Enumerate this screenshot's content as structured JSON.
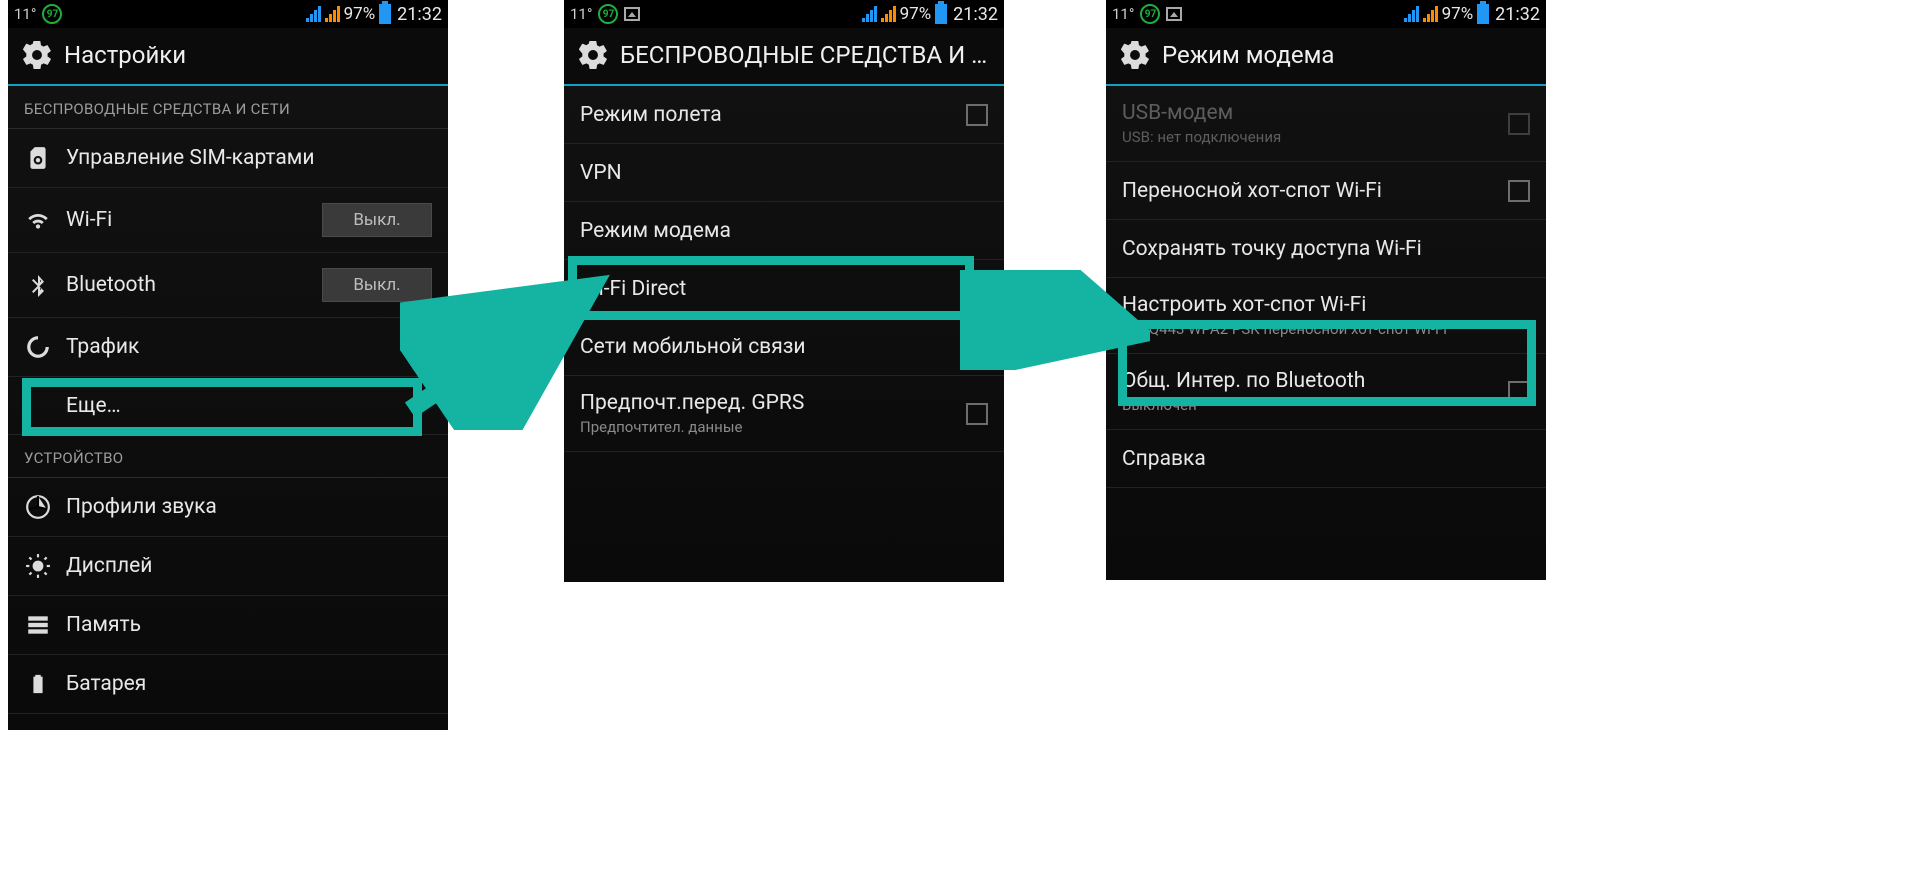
{
  "status": {
    "temp": "11°",
    "badge": "97",
    "battery_pct": "97%",
    "clock": "21:32"
  },
  "screen1": {
    "title": "Настройки",
    "section_wireless": "БЕСПРОВОДНЫЕ СРЕДСТВА И СЕТИ",
    "sim": "Управление SIM-картами",
    "wifi": "Wi-Fi",
    "wifi_toggle": "Выкл.",
    "bt": "Bluetooth",
    "bt_toggle": "Выкл.",
    "traffic": "Трафик",
    "more": "Еще…",
    "section_device": "УСТРОЙСТВО",
    "sound": "Профили звука",
    "display": "Дисплей",
    "memory": "Память",
    "battery": "Батарея"
  },
  "screen2": {
    "title": "БЕСПРОВОДНЫЕ СРЕДСТВА И СЕ…",
    "airplane": "Режим полета",
    "vpn": "VPN",
    "tether": "Режим модема",
    "wifidirect": "Wi-Fi Direct",
    "mobile": "Сети мобильной связи",
    "gprs": "Предпочт.перед. GPRS",
    "gprs_sub": "Предпочтител. данные"
  },
  "screen3": {
    "title": "Режим модема",
    "usb": "USB-модем",
    "usb_sub": "USB: нет подключения",
    "hotspot": "Переносной хот-спот Wi-Fi",
    "keep": "Сохранять точку доступа Wi-Fi",
    "configure": "Настроить хот-спот Wi-Fi",
    "configure_sub": "Fly IQ443 WPA2 PSK переносной хот-спот Wi-Fi",
    "btshare": "Общ. Интер. по Bluetooth",
    "btshare_sub": "Выключен",
    "help": "Справка"
  }
}
